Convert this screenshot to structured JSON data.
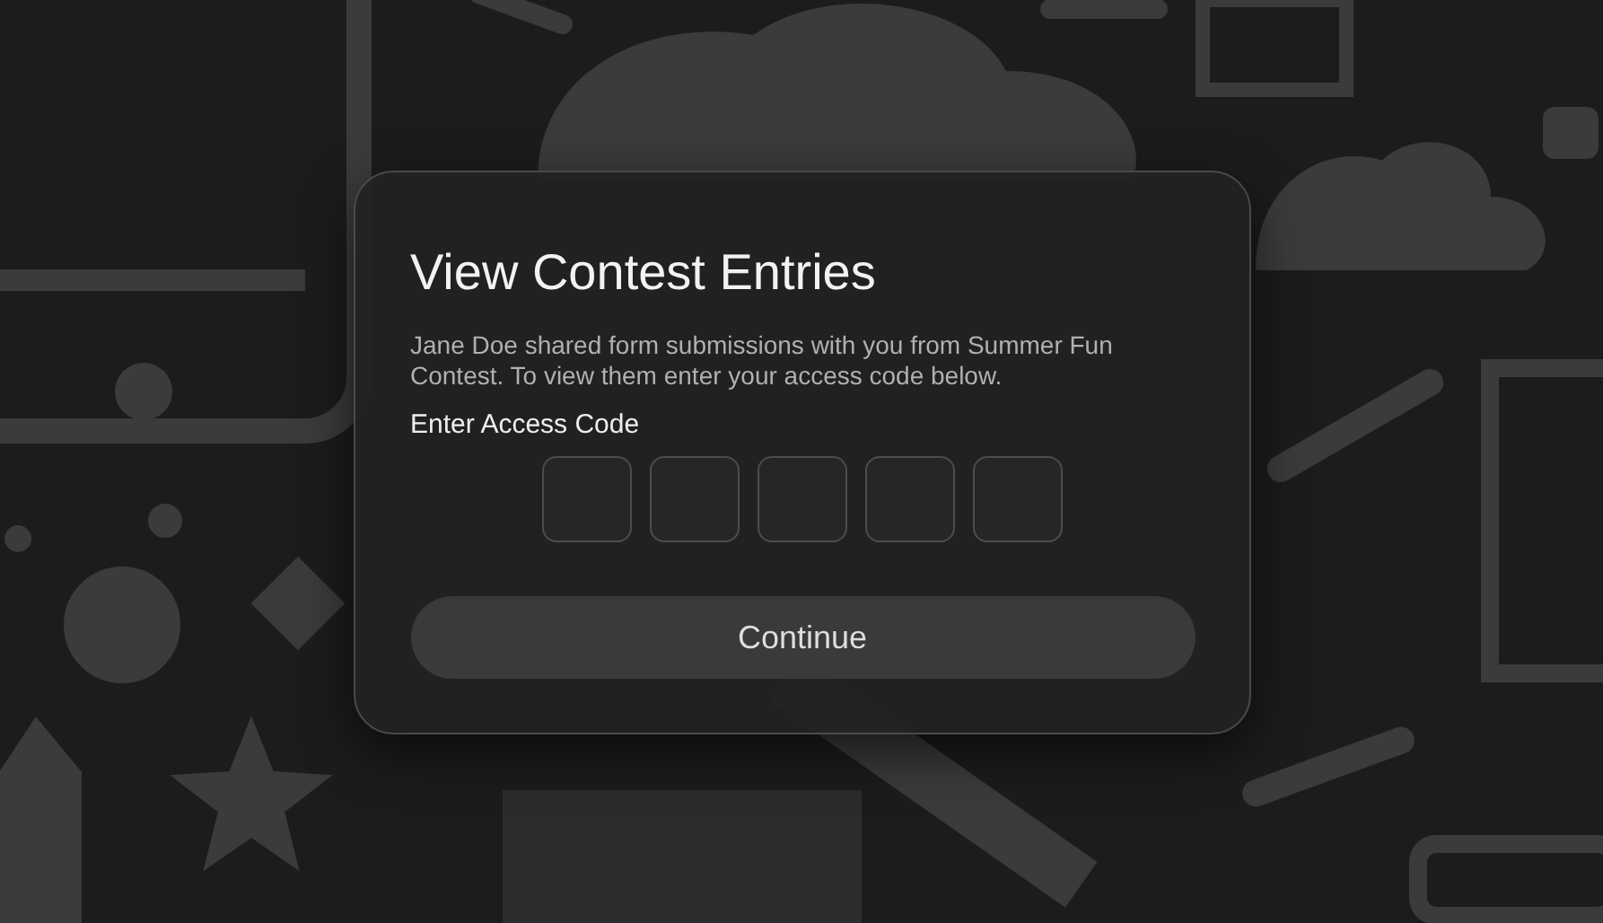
{
  "dialog": {
    "title": "View Contest Entries",
    "message": "Jane Doe shared form submissions with you from Summer Fun Contest. To view them enter your access code below.",
    "code_label": "Enter Access Code",
    "code_fields": [
      {
        "kind": "digit"
      },
      {
        "kind": "digit"
      },
      {
        "kind": "digit"
      },
      {
        "kind": "digit"
      },
      {
        "kind": "digit"
      }
    ],
    "button": "Continue"
  }
}
